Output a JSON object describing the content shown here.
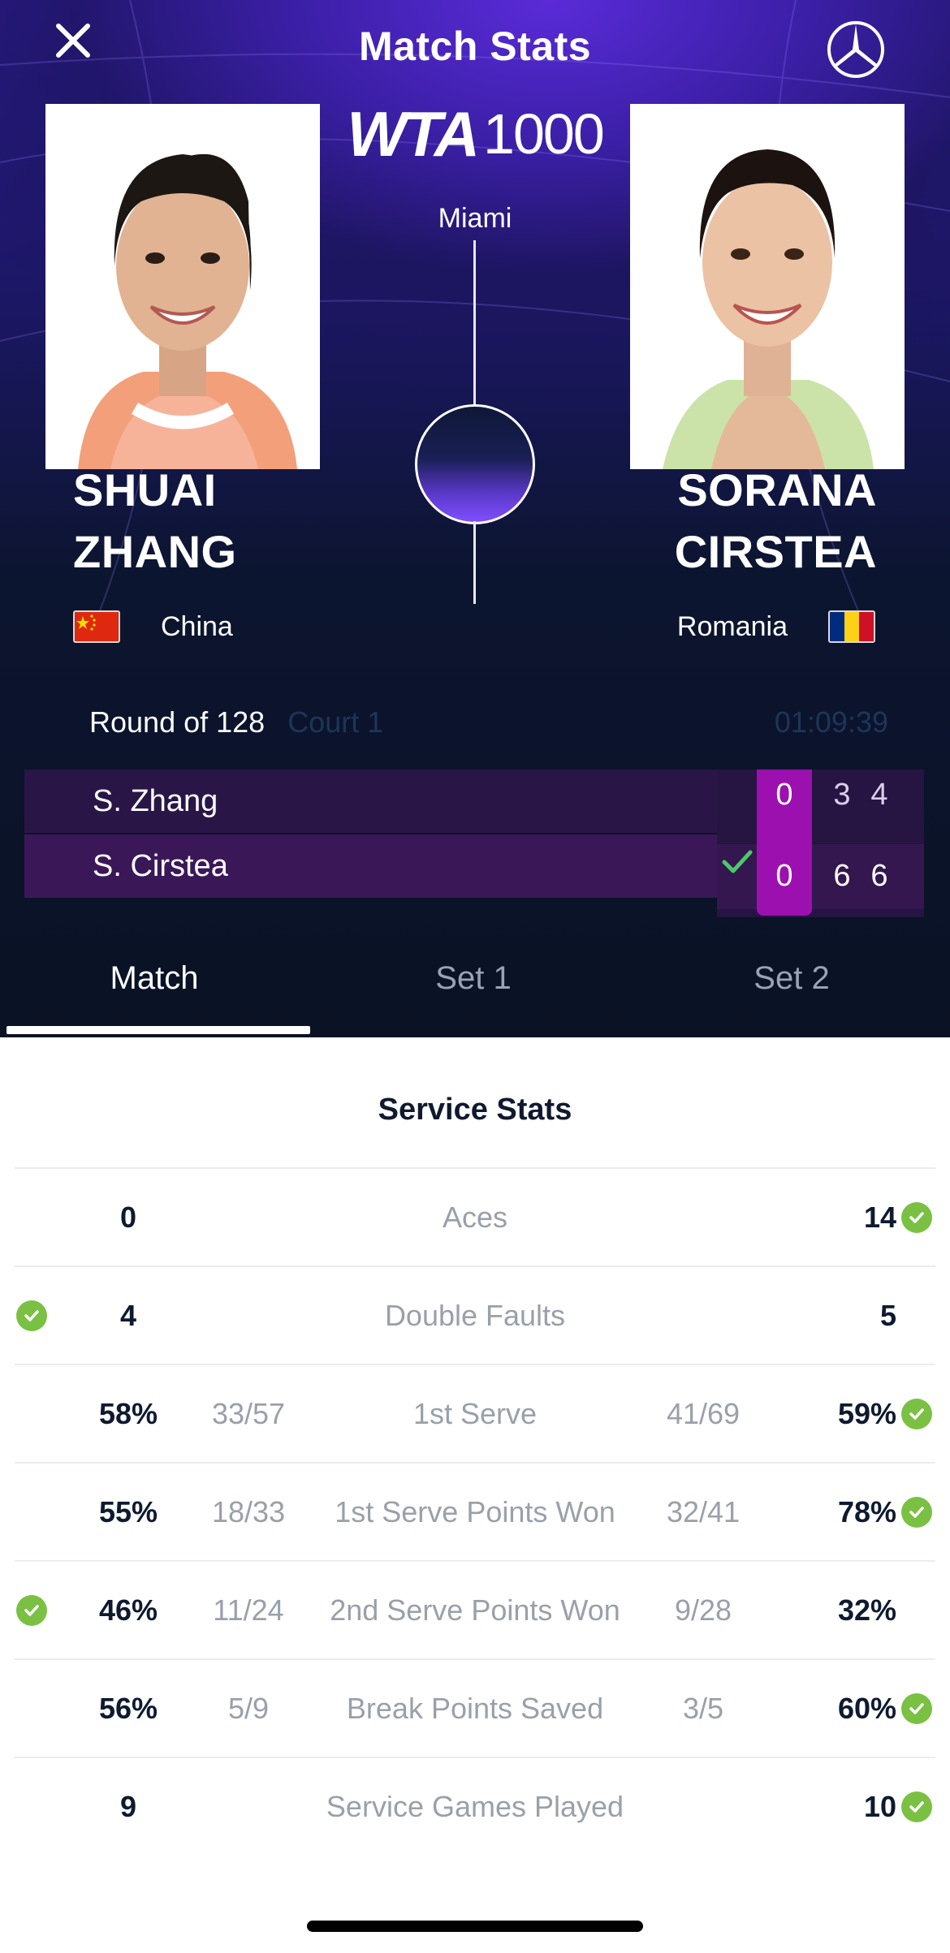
{
  "header": {
    "title": "Match Stats",
    "close_icon": "close-icon",
    "sponsor_icon": "three-pointed-star-logo-icon"
  },
  "tournament": {
    "logo_tour": "WTA",
    "logo_level": "1000",
    "city": "Miami"
  },
  "players": {
    "left": {
      "first": "SHUAI",
      "last": "ZHANG",
      "country": "China",
      "flag": "cn-flag-icon"
    },
    "right": {
      "first": "SORANA",
      "last": "CIRSTEA",
      "country": "Romania",
      "flag": "ro-flag-icon"
    }
  },
  "match_info": {
    "round": "Round of 128",
    "court": "Court 1",
    "duration": "01:09:39"
  },
  "scoreboard": {
    "rows": [
      {
        "name": "S. Zhang",
        "game": "0",
        "set1": "3",
        "set2": "4",
        "winner": false
      },
      {
        "name": "S. Cirstea",
        "game": "0",
        "set1": "6",
        "set2": "6",
        "winner": true
      }
    ]
  },
  "tabs": [
    {
      "label": "Match",
      "active": true
    },
    {
      "label": "Set 1",
      "active": false
    },
    {
      "label": "Set 2",
      "active": false
    }
  ],
  "service_stats": {
    "title": "Service Stats",
    "rows": [
      {
        "label": "Aces",
        "left": "0",
        "left_frac": "",
        "right": "14",
        "right_frac": "",
        "leader": "right"
      },
      {
        "label": "Double Faults",
        "left": "4",
        "left_frac": "",
        "right": "5",
        "right_frac": "",
        "leader": "left"
      },
      {
        "label": "1st Serve",
        "left": "58%",
        "left_frac": "33/57",
        "right": "59%",
        "right_frac": "41/69",
        "leader": "right"
      },
      {
        "label": "1st Serve Points Won",
        "left": "55%",
        "left_frac": "18/33",
        "right": "78%",
        "right_frac": "32/41",
        "leader": "right"
      },
      {
        "label": "2nd Serve Points Won",
        "left": "46%",
        "left_frac": "11/24",
        "right": "32%",
        "right_frac": "9/28",
        "leader": "left"
      },
      {
        "label": "Break Points Saved",
        "left": "56%",
        "left_frac": "5/9",
        "right": "60%",
        "right_frac": "3/5",
        "leader": "right"
      },
      {
        "label": "Service Games Played",
        "left": "9",
        "left_frac": "",
        "right": "10",
        "right_frac": "",
        "leader": "right"
      }
    ]
  },
  "colors": {
    "accent_purple": "#9c10b0",
    "leader_green": "#7ac143",
    "header_dark": "#0a1224"
  }
}
